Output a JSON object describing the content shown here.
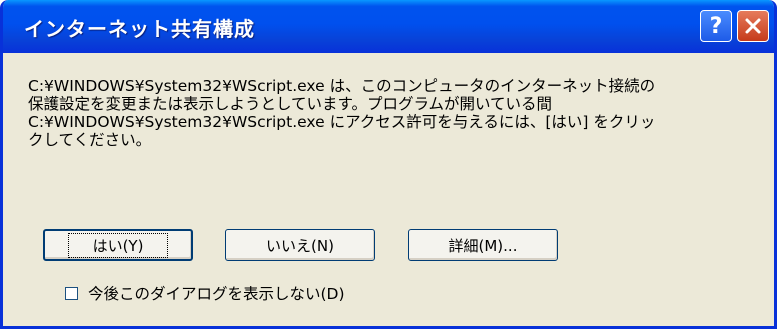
{
  "dialog": {
    "title": "インターネット共有構成",
    "help_button": "?",
    "message_lines": [
      "C:¥WINDOWS¥System32¥WScript.exe は、このコンピュータのインターネット接続の",
      "保護設定を変更または表示しようとしています。プログラムが開いている間",
      "C:¥WINDOWS¥System32¥WScript.exe にアクセス許可を与えるには、[はい] をクリッ",
      "クしてください。"
    ],
    "buttons": {
      "yes": "はい(Y)",
      "no": "いいえ(N)",
      "details": "詳細(M)..."
    },
    "checkbox": {
      "label": "今後このダイアログを表示しない(D)",
      "checked": false
    }
  },
  "colors": {
    "titlebar": "#0050EE",
    "frame": "#0831D9",
    "dialog_bg": "#ECE9D8",
    "close_button": "#D5512B"
  }
}
